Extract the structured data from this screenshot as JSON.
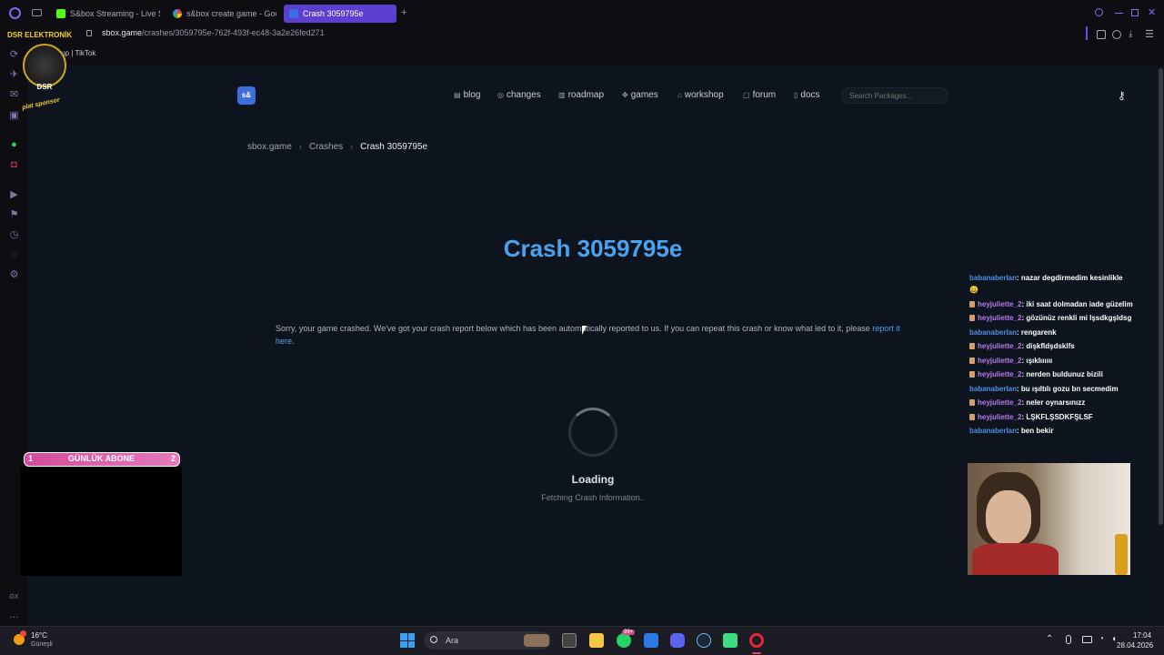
{
  "browser": {
    "tabs": [
      {
        "label": "S&box Streaming - Live St",
        "active": false
      },
      {
        "label": "s&box create game - Goo",
        "active": false
      },
      {
        "label": "Crash 3059795e",
        "active": true
      }
    ],
    "url_host": "sbox.game",
    "url_path": "/crashes/3059795e-762f-493f-ec48-3a2e26fed271",
    "bookmark": "Sign up | TikTok"
  },
  "site": {
    "logo": "s&",
    "nav": [
      {
        "icon": "blog-icon",
        "label": "blog"
      },
      {
        "icon": "changes-icon",
        "label": "changes"
      },
      {
        "icon": "roadmap-icon",
        "label": "roadmap"
      },
      {
        "icon": "games-icon",
        "label": "games"
      },
      {
        "icon": "workshop-icon",
        "label": "workshop"
      },
      {
        "icon": "forum-icon",
        "label": "forum"
      },
      {
        "icon": "docs-icon",
        "label": "docs"
      }
    ],
    "search_placeholder": "Search Packages...",
    "breadcrumb": [
      "sbox.game",
      "Crashes",
      "Crash 3059795e"
    ],
    "title": "Crash 3059795e",
    "message_text": "Sorry, your game crashed. We've got your crash report below which has been automatically reported to us. If you can repeat this crash or know what led to it, please ",
    "message_link": "report it here",
    "message_end": ".",
    "loading_title": "Loading",
    "loading_sub": "Fetching Crash Information.."
  },
  "overlay": {
    "sponsor_name": "DSR ELEKTRONİK",
    "sponsor_badge": "DSR",
    "sponsor_tag": "plat sponsor",
    "sub_bar": {
      "left": "1",
      "label": "GÜNLÜK ABONE",
      "right": "2"
    },
    "chat": [
      {
        "user": "babanaberlan",
        "color": "u1",
        "badge": false,
        "text": ": nazar degdirmedim kesinlikle 😄"
      },
      {
        "user": "heyjuliette_2",
        "color": "u2",
        "badge": true,
        "text": ": iki saat dolmadan iade güzelim"
      },
      {
        "user": "heyjuliette_2",
        "color": "u2",
        "badge": true,
        "text": ": gözünüz renkli mi lşsdkgşldsg"
      },
      {
        "user": "babanaberlan",
        "color": "u1",
        "badge": false,
        "text": ": rengarenk"
      },
      {
        "user": "heyjuliette_2",
        "color": "u2",
        "badge": true,
        "text": ": dişkfldşdsklfs"
      },
      {
        "user": "heyjuliette_2",
        "color": "u2",
        "badge": true,
        "text": ": ışıklıııııı"
      },
      {
        "user": "heyjuliette_2",
        "color": "u2",
        "badge": true,
        "text": ": nerden buldunuz bizili"
      },
      {
        "user": "babanaberlan",
        "color": "u1",
        "badge": false,
        "text": ": bu ışıltılı gozu bn secmedim"
      },
      {
        "user": "heyjuliette_2",
        "color": "u2",
        "badge": true,
        "text": ": neler oynarsınızz"
      },
      {
        "user": "heyjuliette_2",
        "color": "u2",
        "badge": true,
        "text": ": LŞKFLŞSDKFŞLSF"
      },
      {
        "user": "babanaberlan",
        "color": "u1",
        "badge": false,
        "text": ": ben bekir"
      }
    ]
  },
  "taskbar": {
    "weather_temp": "16°C",
    "weather_desc": "Güneşli",
    "search_label": "Ara",
    "notification_badge": "99+",
    "time": "17:04",
    "date": "28.04.2026"
  },
  "colors": {
    "accent": "#4aa3f0",
    "active_tab": "#5b3fd0",
    "site_bg": "#0e141d"
  }
}
